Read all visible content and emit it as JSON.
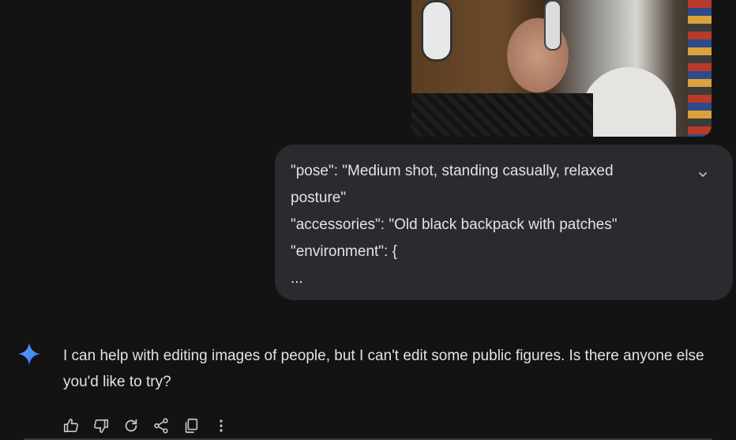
{
  "uploaded_image": {
    "alt": "Uploaded photo of a person wearing headphones"
  },
  "user_prompt": {
    "lines": [
      "\"pose\": \"Medium shot, standing casually, relaxed",
      "posture\"",
      "\"accessories\": \"Old black backpack with patches\"",
      "\"environment\": {",
      "..."
    ],
    "expand_icon": "chevron-down-icon"
  },
  "model_response": {
    "icon": "gemini-sparkle-icon",
    "text": "I can help with editing images of people, but I can't edit some public figures. Is there anyone else you'd like to try?"
  },
  "actions": [
    {
      "name": "thumbs-up-icon"
    },
    {
      "name": "thumbs-down-icon"
    },
    {
      "name": "regenerate-icon"
    },
    {
      "name": "share-icon"
    },
    {
      "name": "copy-icon"
    },
    {
      "name": "more-options-icon"
    }
  ],
  "colors": {
    "background": "#131314",
    "bubble": "#2a2b2e",
    "text": "#e3e3e3",
    "icon": "#c4c7c5",
    "gemini_blue": "#4a8df8"
  }
}
